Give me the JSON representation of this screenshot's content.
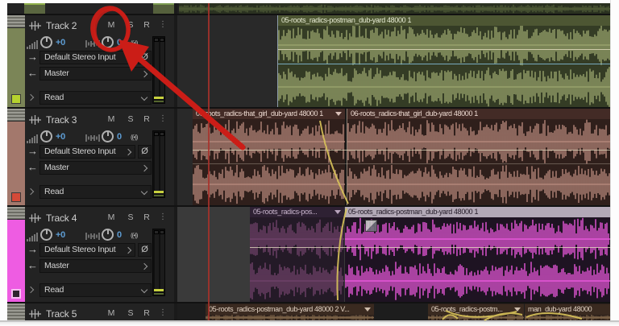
{
  "window": {
    "description": "audio multitrack editor"
  },
  "track_controls": {
    "mute": "M",
    "solo": "S",
    "record": "R",
    "more": "⋮",
    "monitor": "((•))",
    "phase": "Ø"
  },
  "tracks": [
    {
      "name": "Track 2",
      "gain": "+0",
      "pan": "0",
      "input": "Default Stereo Input",
      "output": "Master",
      "automation": "Read"
    },
    {
      "name": "Track 3",
      "gain": "+0",
      "pan": "0",
      "input": "Default Stereo Input",
      "output": "Master",
      "automation": "Read"
    },
    {
      "name": "Track 4",
      "gain": "+0",
      "pan": "0",
      "input": "Default Stereo Input",
      "output": "Master",
      "automation": "Read"
    },
    {
      "name": "Track 5"
    }
  ],
  "clips": {
    "track2": [
      {
        "label": "05-roots_radics-postman_dub-yard 48000 1"
      }
    ],
    "track3": [
      {
        "label": "06-roots_radics-that_girl_dub-yard 48000 1"
      },
      {
        "label": "06-roots_radics-that_girl_dub-yard 48000 1"
      }
    ],
    "track4": [
      {
        "label": "05-roots_radics-pos..."
      },
      {
        "label": "05-roots_radics-postman_dub-yard 48000 1",
        "selected": true
      }
    ],
    "track5": [
      {
        "label": "05-roots_radics-postman_dub-yard 48000 2 V..."
      },
      {
        "label": "05-roots_radics-postm..."
      },
      {
        "label": "man_dub-yard 48000"
      }
    ]
  },
  "palette": {
    "track1": {
      "wave": "#4e5a36",
      "bg": "#2a3120"
    },
    "track2": {
      "wave": "#97a26b",
      "bg": "#343c25",
      "header": "#4d5633",
      "headerText": "#e6ead2",
      "strip": "#7b8557",
      "btn": "#b6d22e"
    },
    "track3": {
      "wave": "#b38679",
      "bg": "#2f1f1b",
      "header": "#432b26",
      "headerText": "#eedbd2",
      "strip": "#a3786c",
      "btn": "#d44a38"
    },
    "track4a": {
      "wave": "#6e4168",
      "bg": "#241a27",
      "header": "#2e2133",
      "headerText": "#cab6ce"
    },
    "track4b": {
      "wave": "#e556d8",
      "bg": "#1e1322",
      "header": "#b3a9b7",
      "headerText": "#231a27",
      "strip": "#ee5ce2"
    },
    "track5": {
      "wave": "#7d6348",
      "bg": "#2c201a",
      "header": "#3a2a20",
      "headerText": "#e2d2c2",
      "strip": "#8f7a66"
    }
  },
  "envelope_colors": {
    "volume": "#eae3c6",
    "pan": "#7fb6cf",
    "fade": "#d9c45a"
  },
  "playhead_color": "#a8312a",
  "annotation": {
    "color": "#cb1d17",
    "target": "track-2-mute-button"
  }
}
